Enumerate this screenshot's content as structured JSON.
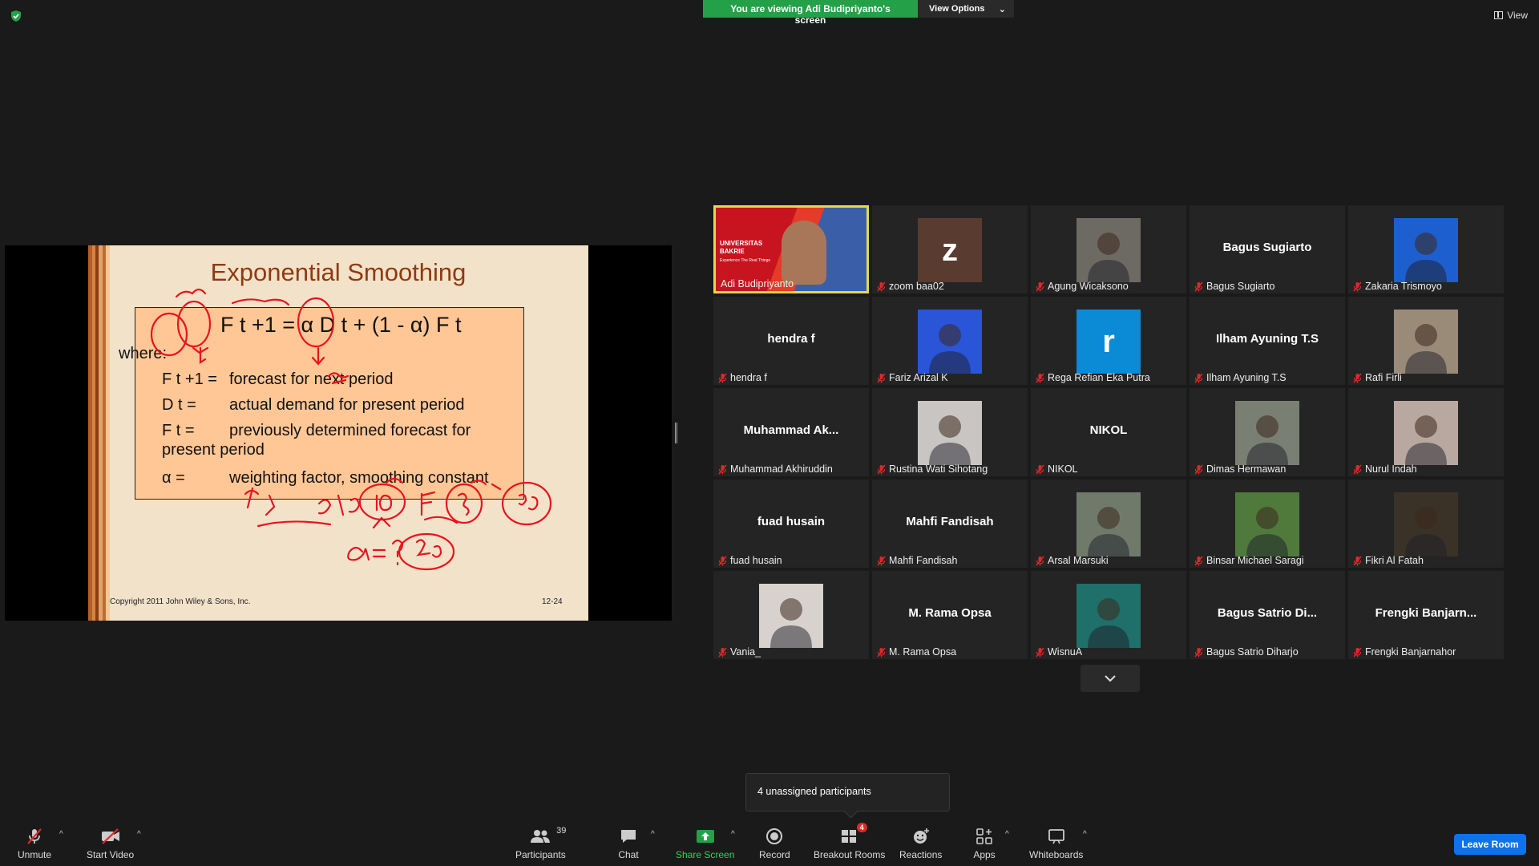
{
  "top_bar": {
    "viewing_text": "You are viewing Adi Budipriyanto's screen",
    "view_options_label": "View Options",
    "view_label": "View"
  },
  "slide": {
    "title": "Exponential Smoothing",
    "formula": "F t +1 = α D t + (1 - α) F t",
    "where": "where:",
    "def1_sym": "F t +1 =",
    "def1_text": "forecast for next period",
    "def2_sym": "D t =",
    "def2_text": "actual demand for present period",
    "def3_sym": "F t =",
    "def3_text": "previously determined forecast for",
    "def3_text2": "present period",
    "def4_sym": "α =",
    "def4_text": "weighting factor, smoothing constant",
    "copyright": "Copyright 2011 John Wiley & Sons, Inc.",
    "page": "12-24"
  },
  "participants": [
    {
      "name": "Adi Budipriyanto",
      "display": "",
      "type": "video",
      "active": true,
      "muted": false
    },
    {
      "name": "zoom baa02",
      "display": "z",
      "type": "letter",
      "color": "#5a3b2f",
      "muted": true
    },
    {
      "name": "Agung Wicaksono",
      "display": "",
      "type": "photo",
      "color": "#6d6a63",
      "muted": true
    },
    {
      "name": "Bagus Sugiarto",
      "display": "Bagus Sugiarto",
      "type": "text",
      "muted": true
    },
    {
      "name": "Zakaria Trismoyo",
      "display": "",
      "type": "photo",
      "color": "#1e5fcf",
      "muted": true
    },
    {
      "name": "hendra f",
      "display": "hendra f",
      "type": "text",
      "muted": true
    },
    {
      "name": "Fariz Arizal K",
      "display": "",
      "type": "photo",
      "color": "#2a55d8",
      "muted": true
    },
    {
      "name": "Rega Refian Eka Putra",
      "display": "r",
      "type": "letter",
      "color": "#0b8ad6",
      "muted": true
    },
    {
      "name": "Ilham Ayuning T.S",
      "display": "Ilham Ayuning T.S",
      "type": "text",
      "muted": true
    },
    {
      "name": "Rafi Firli",
      "display": "",
      "type": "photo",
      "color": "#9a8a78",
      "muted": true
    },
    {
      "name": "Muhammad Akhiruddin",
      "display": "Muhammad  Ak...",
      "type": "text",
      "muted": true
    },
    {
      "name": "Rustina Wati Sihotang",
      "display": "",
      "type": "photo",
      "color": "#c9c5c2",
      "muted": true
    },
    {
      "name": "NIKOL",
      "display": "NIKOL",
      "type": "text",
      "muted": true
    },
    {
      "name": "Dimas Hermawan",
      "display": "",
      "type": "photo",
      "color": "#7a7f73",
      "muted": true
    },
    {
      "name": "Nurul Indah",
      "display": "",
      "type": "photo",
      "color": "#b9a8a0",
      "muted": true
    },
    {
      "name": "fuad husain",
      "display": "fuad husain",
      "type": "text",
      "muted": true
    },
    {
      "name": "Mahfi Fandisah",
      "display": "Mahfi Fandisah",
      "type": "text",
      "muted": true
    },
    {
      "name": "Arsal Marsuki",
      "display": "",
      "type": "photo",
      "color": "#6f7a6b",
      "muted": true
    },
    {
      "name": "Binsar Michael Saragi",
      "display": "",
      "type": "photo",
      "color": "#4f7a3c",
      "muted": true
    },
    {
      "name": "Fikri Al Fatah",
      "display": "",
      "type": "photo",
      "color": "#3a3226",
      "muted": true
    },
    {
      "name": "Vania_",
      "display": "",
      "type": "photo",
      "color": "#d8d2cf",
      "muted": true
    },
    {
      "name": "M. Rama Opsa",
      "display": "M. Rama Opsa",
      "type": "text",
      "muted": true
    },
    {
      "name": "WisnuA",
      "display": "",
      "type": "photo",
      "color": "#1f6f6a",
      "muted": true
    },
    {
      "name": "Bagus Satrio Diharjo",
      "display": "Bagus  Satrio  Di...",
      "type": "text",
      "muted": true
    },
    {
      "name": "Frengki Banjarnahor",
      "display": "Frengki  Banjarn...",
      "type": "text",
      "muted": true
    }
  ],
  "video_tile_text": {
    "org": "UNIVERSITAS BAKRIE",
    "tagline": "Experience The Real Things"
  },
  "unassigned": "4 unassigned participants",
  "toolbar": {
    "unmute": "Unmute",
    "start_video": "Start Video",
    "participants": "Participants",
    "participants_count": "39",
    "chat": "Chat",
    "share_screen": "Share Screen",
    "record": "Record",
    "breakout_rooms": "Breakout Rooms",
    "breakout_badge": "4",
    "reactions": "Reactions",
    "apps": "Apps",
    "whiteboards": "Whiteboards",
    "leave": "Leave Room"
  },
  "colors": {
    "accent_green": "#24a148",
    "leave_blue": "#0e72ed",
    "active_border": "#e4d84a",
    "mute_red": "#e02828",
    "annotation_red": "#e8141e"
  }
}
